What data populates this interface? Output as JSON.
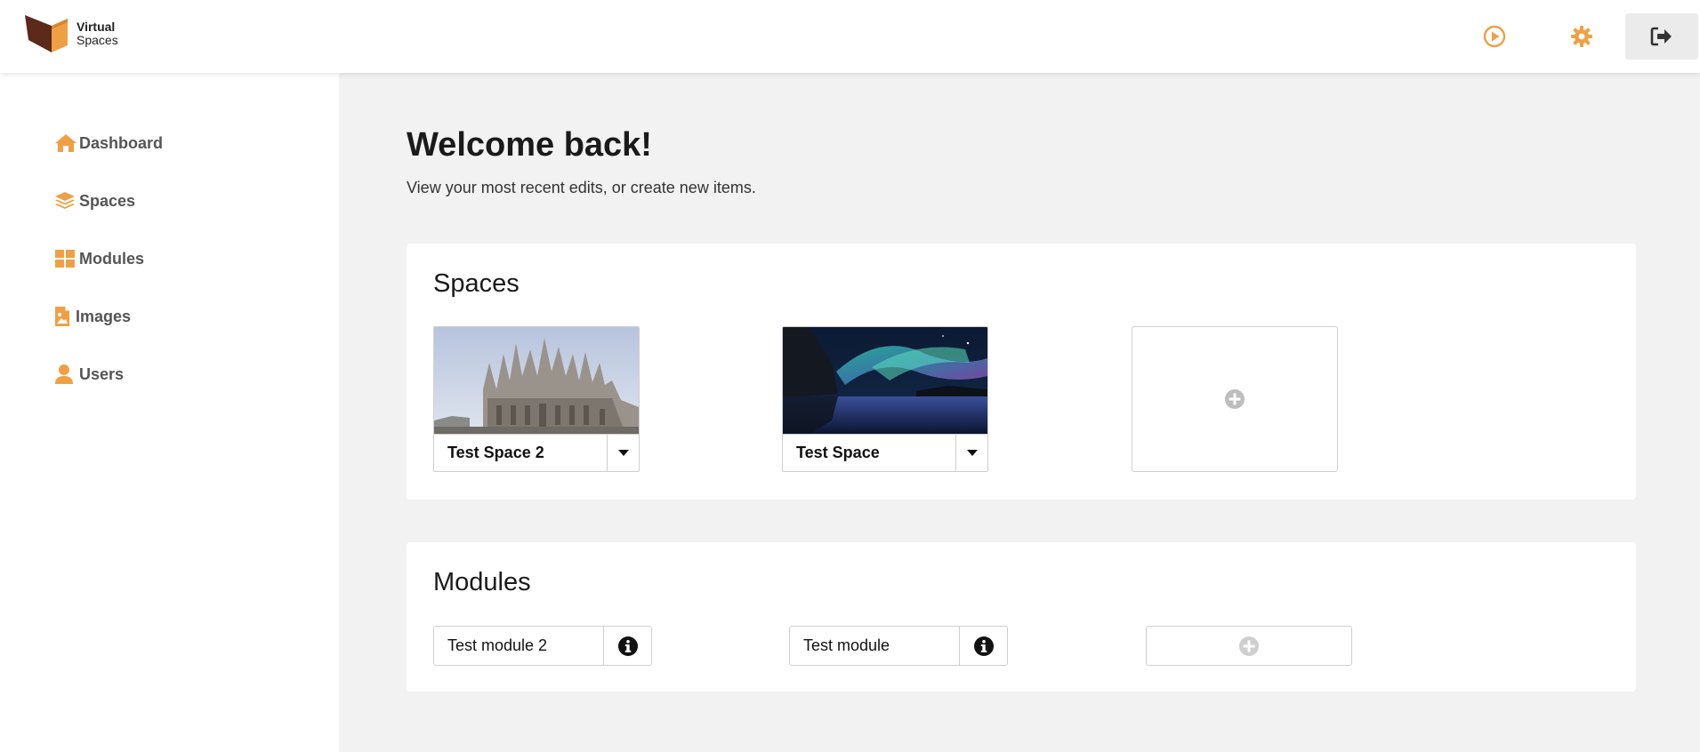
{
  "header": {
    "logo_line1": "Virtual",
    "logo_line2": "Spaces",
    "play_icon": "play-circle-icon",
    "settings_icon": "gear-icon",
    "logout_icon": "sign-out-icon"
  },
  "sidebar": {
    "items": [
      {
        "label": "Dashboard",
        "icon": "home-icon"
      },
      {
        "label": "Spaces",
        "icon": "layers-icon"
      },
      {
        "label": "Modules",
        "icon": "grid-icon"
      },
      {
        "label": "Images",
        "icon": "image-file-icon"
      },
      {
        "label": "Users",
        "icon": "user-icon"
      }
    ]
  },
  "main": {
    "title": "Welcome back!",
    "subtitle": "View your most recent edits, or create new items."
  },
  "spaces": {
    "title": "Spaces",
    "items": [
      {
        "name": "Test Space 2",
        "thumbnail": "cathedral photo"
      },
      {
        "name": "Test Space",
        "thumbnail": "aurora over lake photo"
      }
    ],
    "add_icon": "plus-circle-icon"
  },
  "modules": {
    "title": "Modules",
    "items": [
      {
        "name": "Test module 2",
        "icon": "info-icon"
      },
      {
        "name": "Test module",
        "icon": "info-icon"
      }
    ],
    "add_icon": "plus-circle-icon"
  },
  "colors": {
    "accent": "#f0a044",
    "logo_dark": "#5c2a1a",
    "page_bg": "#f2f2f2",
    "nav_text": "#555555"
  }
}
